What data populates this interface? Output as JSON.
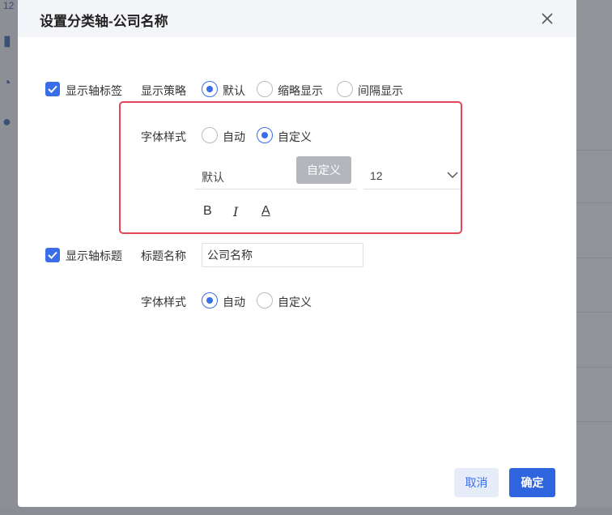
{
  "dialog": {
    "title": "设置分类轴-公司名称",
    "cancel_label": "取消",
    "ok_label": "确定"
  },
  "axis_label": {
    "checkbox_label": "显示轴标签",
    "checked": true,
    "strategy_label": "显示策略",
    "strategy_options": [
      "默认",
      "缩略显示",
      "间隔显示"
    ],
    "strategy_selected": "默认",
    "font_style_label": "字体样式",
    "font_style_options": [
      "自动",
      "自定义"
    ],
    "font_style_selected": "自定义",
    "font_family_value": "默认",
    "font_size_value": "12",
    "tooltip_text": "自定义",
    "format_icons": [
      "B",
      "I",
      "A"
    ]
  },
  "axis_title": {
    "checkbox_label": "显示轴标题",
    "checked": true,
    "title_name_label": "标题名称",
    "title_name_value": "公司名称",
    "font_style_label": "字体样式",
    "font_style_options": [
      "自动",
      "自定义"
    ],
    "font_style_selected": "自动"
  },
  "colors": {
    "accent": "#3a6ee8",
    "highlight_border": "#e8455a"
  }
}
